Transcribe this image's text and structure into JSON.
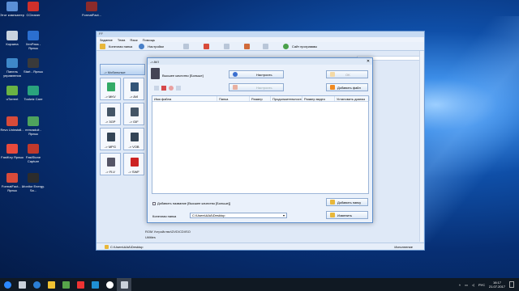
{
  "desktop": {
    "icons": [
      {
        "label": "Этот компьютер",
        "color": "#5b8fd6"
      },
      {
        "label": "Корзина",
        "color": "#c9d3df"
      },
      {
        "label": "Панель управления",
        "color": "#3e88c9"
      },
      {
        "label": "uTorrent",
        "color": "#6ab344"
      },
      {
        "label": "Revo Uninstall...",
        "color": "#d84b3a"
      },
      {
        "label": "FastKey Ярлык",
        "color": "#e84a3c"
      },
      {
        "label": "FormatFact... - Ярлык",
        "color": "#d84b3a"
      },
      {
        "label": "CCleaner",
        "color": "#d0302b"
      },
      {
        "label": "XenPass - Ярлык",
        "color": "#2b6fd0"
      },
      {
        "label": "Start - Ярлык",
        "color": "#3a3a3a"
      },
      {
        "label": "Toolwiz Care",
        "color": "#2aa37d"
      },
      {
        "label": "mmvaduit - Ярлык",
        "color": "#4ea35d"
      },
      {
        "label": "FastStone Capture",
        "color": "#c0392b"
      },
      {
        "label": "Monitor Energy. Sa...",
        "color": "#2c2c2c"
      },
      {
        "label": "FormatFact...",
        "color": "#8b2b2b"
      }
    ]
  },
  "window": {
    "title": "FF",
    "menu": [
      "Задание",
      "Тема",
      "Язык",
      "Помощь"
    ],
    "toolbar": {
      "output_folder": "Конечная папка",
      "settings": "Настройки",
      "site": "Сайт программы"
    },
    "list_header": "Папка",
    "side": {
      "category_mobile": "-> Мобильные",
      "formats": [
        {
          "label": "-> MKV",
          "left": "#3a6",
          "right": "#357"
        },
        {
          "label": "-> AVI",
          "left": "#357",
          "right": "#357"
        },
        {
          "label": "-> 3GP",
          "left": "#456",
          "right": "#456"
        },
        {
          "label": "-> GIF",
          "left": "#456",
          "right": "#456"
        },
        {
          "label": "-> MPG",
          "left": "#345",
          "right": "#345"
        },
        {
          "label": "-> VOB",
          "left": "#345",
          "right": "#345"
        },
        {
          "label": "-> FLV",
          "left": "#556",
          "right": "#556"
        },
        {
          "label": "-> SWF",
          "left": "#c22",
          "right": "#c22"
        }
      ],
      "bottom_text_1": "ROM Устройство\\DVD\\CD\\ISO",
      "bottom_text_2": "Utilities"
    },
    "status_left": "C:\\Users\\AAA\\Desktop",
    "status_right": "Исполнение"
  },
  "dialog": {
    "title": "-> AVI",
    "quality_label": "Высшее качество [Больше]",
    "btn_setup": "Настроить",
    "btn_disabled": "Настроить",
    "btn_ok": "OK",
    "btn_add_file": "Добавить файл",
    "columns": [
      "Имя файла",
      "Папка",
      "Размер",
      "Продолжительность",
      "Размер видео",
      "Установить диапаз"
    ],
    "checkbox_label": "Добавить название [Высшее качество [Больше]]",
    "btn_add_folder": "Добавить папку",
    "destination_label": "Конечная папка",
    "destination_value": "C:\\Users\\AAA\\Desktop",
    "btn_change": "Изменить"
  },
  "taskbar": {
    "lang": "РУС",
    "time": "16:17",
    "date": "21.07.2017",
    "items": [
      {
        "name": "start-button",
        "color": "#2b88ff"
      },
      {
        "name": "task-view",
        "color": "#c9d1db"
      },
      {
        "name": "edge",
        "color": "#2b7fd6"
      },
      {
        "name": "explorer",
        "color": "#f1c232"
      },
      {
        "name": "store",
        "color": "#57a64a"
      },
      {
        "name": "yandex-search",
        "color": "#e33"
      },
      {
        "name": "app-skype",
        "color": "#1f8fd3"
      },
      {
        "name": "yandex-browser",
        "color": "#ffffff"
      },
      {
        "name": "formatfactory",
        "color": "#c9d1db"
      }
    ]
  }
}
